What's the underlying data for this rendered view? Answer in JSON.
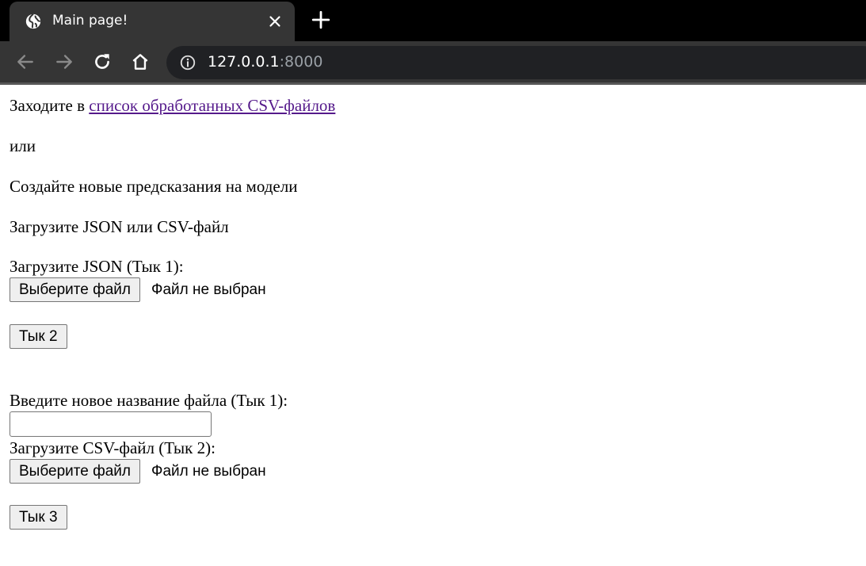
{
  "browser": {
    "tab_title": "Main page!",
    "url_host": "127.0.0.1",
    "url_port": ":8000"
  },
  "page": {
    "intro_text": "Заходите в ",
    "intro_link": "список обработанных CSV-файлов",
    "or_text": "или",
    "create_text": "Создайте новые предсказания на модели",
    "upload_heading": "Загрузите JSON или CSV-файл",
    "json_label": "Загрузите JSON (Тык 1):",
    "choose_file_label": "Выберите файл",
    "no_file_text": "Файл не выбран",
    "submit2_label": "Тык 2",
    "new_name_label": "Введите новое название файла (Тык 1):",
    "new_name_value": "",
    "csv_label": "Загрузите CSV-файл (Тык 2):",
    "choose_file_label_2": "Выберите файл",
    "no_file_text_2": "Файл не выбран",
    "submit3_label": "Тык 3"
  },
  "colors": {
    "link": "#551a8b",
    "toolbar": "#353535",
    "tabstrip": "#000000"
  }
}
